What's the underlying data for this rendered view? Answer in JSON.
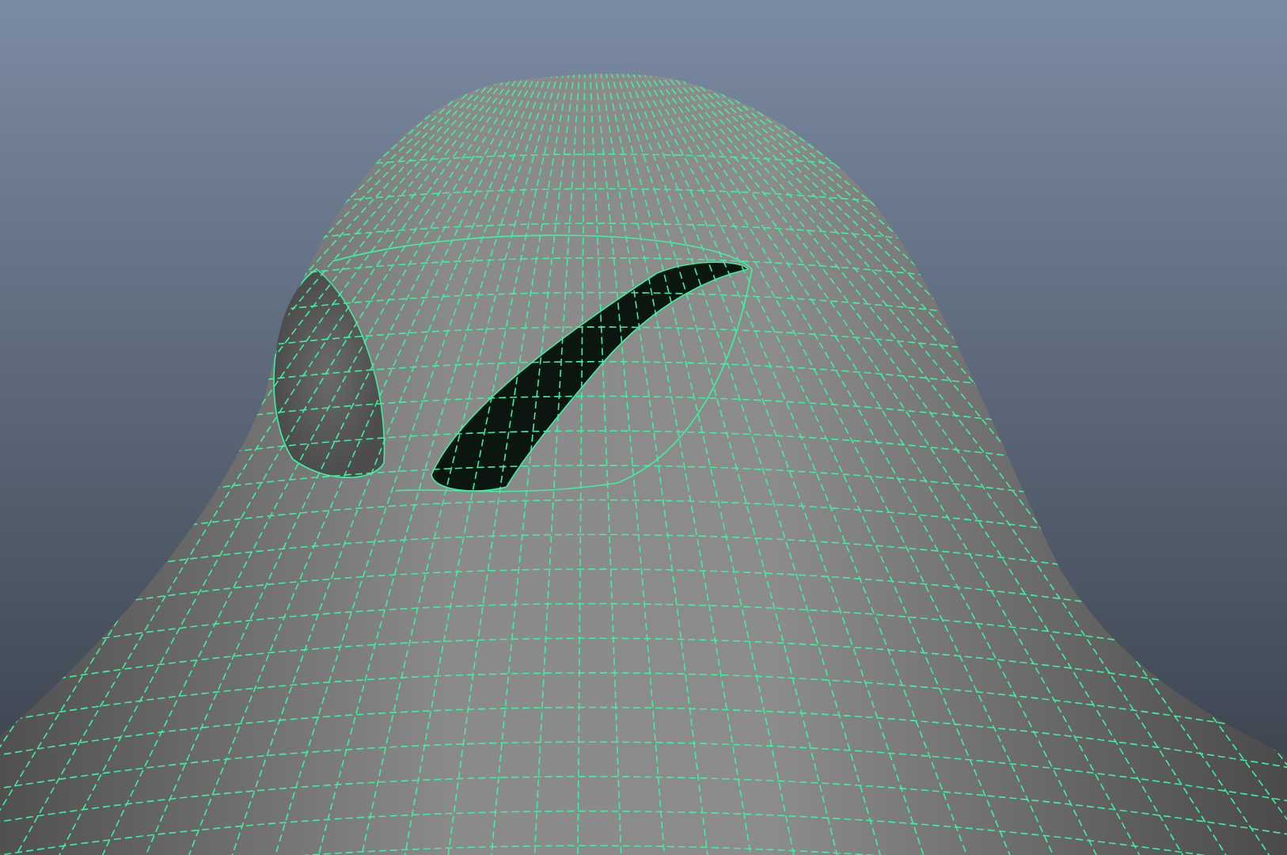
{
  "viewport": {
    "mesh": {
      "wireframe": true,
      "shaded": true
    }
  }
}
